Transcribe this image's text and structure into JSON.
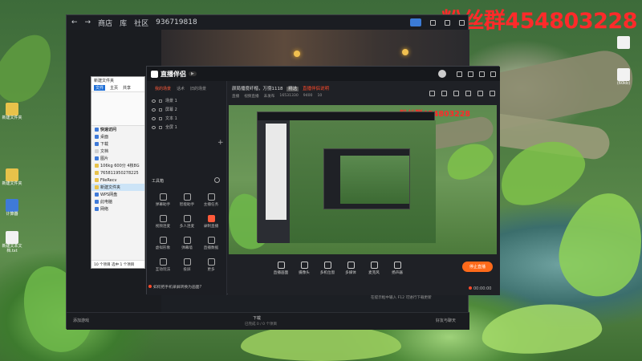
{
  "watermark": "粉丝群454803228",
  "desktop": {
    "icons": [
      {
        "label": "新建文件夹",
        "color": "#e8c24a"
      },
      {
        "label": "新建文件夹",
        "color": "#e8c24a"
      },
      {
        "label": "计算器",
        "color": "#3f7ad8"
      },
      {
        "label": "新建文本文档.txt",
        "color": "#f2f2f2"
      }
    ],
    "right_icon_label": "(60kb)"
  },
  "store": {
    "nav_back": "←",
    "nav_forward": "→",
    "nav_items": [
      "商店",
      "库",
      "社区"
    ],
    "user_id": "936719818",
    "bottom_center": "下载",
    "bottom_sub": "已完成 0 / 0 个项目",
    "bottom_left": "添加游戏",
    "bottom_right": "好友与聊天"
  },
  "explorer": {
    "title": "新建文件夹",
    "tabs": [
      "文件",
      "主页",
      "共享"
    ],
    "quick_access": "快速访问",
    "items": [
      {
        "label": "桌面",
        "color": "#3f7ad8"
      },
      {
        "label": "下载",
        "color": "#3f7ad8"
      },
      {
        "label": "文档",
        "color": "#cfcfcf"
      },
      {
        "label": "图片",
        "color": "#3f7ad8"
      },
      {
        "label": "106kg 600分 4核8G",
        "color": "#e8c24a"
      },
      {
        "label": "765811950278225",
        "color": "#e8c24a"
      },
      {
        "label": "FileRecv",
        "color": "#e8c24a"
      },
      {
        "label": "新建文件夹",
        "color": "#e8c24a"
      },
      {
        "label": "WPS网盘",
        "color": "#3f7ad8"
      },
      {
        "label": "此电脑",
        "color": "#3f7ad8"
      },
      {
        "label": "网络",
        "color": "#3f7ad8"
      }
    ],
    "status": "10 个项目  选中 1 个项目"
  },
  "app": {
    "logo": "直播伴侣",
    "header_title": "颜局播度纤楷，万捌1118",
    "badge": "精选",
    "header_red": "直播伴侣说明",
    "header_sub": [
      "直播",
      "视频直播",
      "未发布"
    ],
    "header_stats": [
      "16531330",
      "9400",
      "10"
    ],
    "left_tabs": [
      "我的场景",
      "话术",
      "旧的场景"
    ],
    "layers": [
      "场景 1",
      "屏幕 2",
      "文本 1",
      "全屏 1"
    ],
    "toolbox_title": "工具箱",
    "tools": [
      {
        "label": "弹幕助手"
      },
      {
        "label": "智能助手"
      },
      {
        "label": "主播任务"
      },
      {
        "label": "视频连麦"
      },
      {
        "label": "多人连麦"
      },
      {
        "label": "录制直播"
      },
      {
        "label": "虚拟形象"
      },
      {
        "label": "弹幕墙"
      },
      {
        "label": "直播数据"
      },
      {
        "label": "互动玩法"
      },
      {
        "label": "投屏"
      },
      {
        "label": "更多"
      }
    ],
    "notice": "如何把手机录屏转换为画面?",
    "bottom_tools": [
      "直播画面",
      "摄像头",
      "多机位窗",
      "多媒体",
      "麦克风",
      "扬声器"
    ],
    "live_button": "停止直播",
    "timer": "00:00:00",
    "footer_text": "在提示框中输入 F12 可进行下载更新"
  }
}
